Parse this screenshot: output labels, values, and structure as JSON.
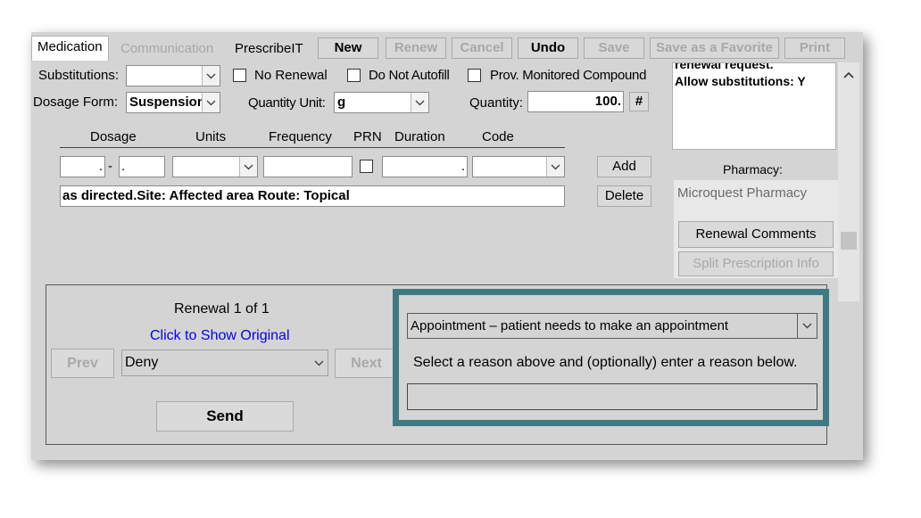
{
  "tabs": [
    {
      "label": "Medication",
      "state": "active"
    },
    {
      "label": "Communication",
      "state": "disabled"
    },
    {
      "label": "PrescribeIT",
      "state": "enabled"
    }
  ],
  "toolbar": {
    "new": "New",
    "renew": "Renew",
    "cancel": "Cancel",
    "undo": "Undo",
    "save": "Save",
    "save_favorite": "Save as a Favorite",
    "print": "Print"
  },
  "form": {
    "substitutions_label": "Substitutions:",
    "substitutions_value": "",
    "no_renewal_label": "No Renewal",
    "do_not_autofill_label": "Do Not Autofill",
    "prov_monitored_label": "Prov. Monitored Compound",
    "dosage_form_label": "Dosage Form:",
    "dosage_form_value": "Suspension",
    "quantity_unit_label": "Quantity Unit:",
    "quantity_unit_value": "g",
    "quantity_label": "Quantity:",
    "quantity_value": "100.",
    "hash_label": "#"
  },
  "dosage_grid": {
    "headers": [
      "Dosage",
      "Units",
      "Frequency",
      "PRN",
      "Duration",
      "Code"
    ],
    "dosage_sep": "-",
    "duration_dot": ".",
    "dosage_dot": ".",
    "instructions": "as directed.Site: Affected area Route: Topical",
    "add_label": "Add",
    "delete_label": "Delete"
  },
  "notes": {
    "line1": "renewal request.",
    "line2": "Allow substitutions: Y"
  },
  "pharmacy": {
    "label": "Pharmacy:",
    "name": "Microquest Pharmacy",
    "renewal_comments": "Renewal Comments",
    "split_info": "Split Prescription Info"
  },
  "renewal": {
    "counter": "Renewal 1 of 1",
    "show_original": "Click to Show Original",
    "prev": "Prev",
    "next": "Next",
    "decision": "Deny",
    "send": "Send"
  },
  "deny_reason": {
    "selected": "Appointment – patient needs to make an appointment",
    "instruction": "Select a reason above and (optionally) enter a reason below.",
    "reason_text": ""
  },
  "colors": {
    "highlight_border": "#3f7a83",
    "link": "#0000ee",
    "panel_bg": "#d4d4d4"
  }
}
